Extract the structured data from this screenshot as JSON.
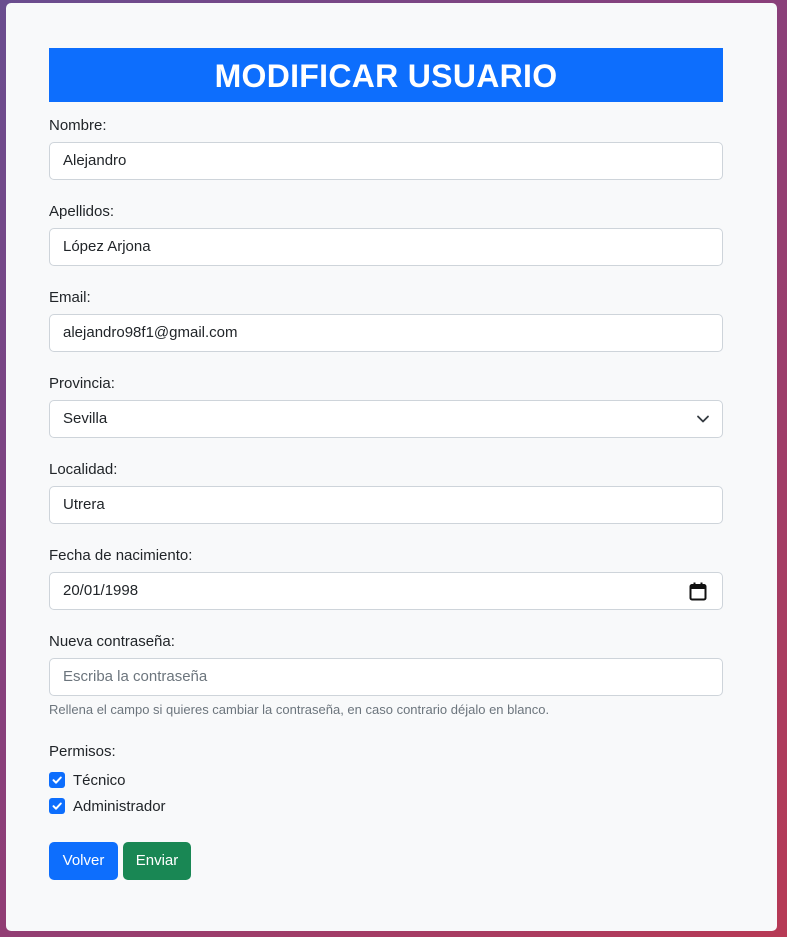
{
  "form": {
    "title": "MODIFICAR USUARIO",
    "nombre": {
      "label": "Nombre:",
      "value": "Alejandro"
    },
    "apellidos": {
      "label": "Apellidos:",
      "value": "López Arjona"
    },
    "email": {
      "label": "Email:",
      "value": "alejandro98f1@gmail.com"
    },
    "provincia": {
      "label": "Provincia:",
      "value": "Sevilla",
      "icon": "chevron-down-icon"
    },
    "localidad": {
      "label": "Localidad:",
      "value": "Utrera"
    },
    "fecha": {
      "label": "Fecha de nacimiento:",
      "value": "20/01/1998",
      "icon": "calendar-icon"
    },
    "password": {
      "label": "Nueva contraseña:",
      "placeholder": "Escriba la contraseña",
      "help": "Rellena el campo si quieres cambiar la contraseña, en caso contrario déjalo en blanco."
    },
    "permisos": {
      "label": "Permisos:",
      "options": [
        {
          "label": "Técnico",
          "checked": true
        },
        {
          "label": "Administrador",
          "checked": true
        }
      ]
    },
    "buttons": {
      "back": "Volver",
      "submit": "Enviar"
    }
  },
  "colors": {
    "primary": "#0d6efd",
    "success": "#198754",
    "card_bg": "#f8f9fa"
  }
}
